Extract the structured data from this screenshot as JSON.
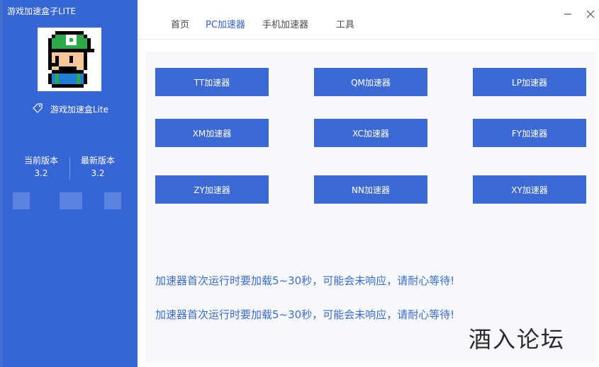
{
  "app": {
    "title": "游戏加速盒子LITE",
    "name": "游戏加速盒Lite"
  },
  "versions": {
    "current_label": "当前版本",
    "current_value": "3.2",
    "latest_label": "最新版本",
    "latest_value": "3.2"
  },
  "nav": {
    "tabs": [
      {
        "label": "首页"
      },
      {
        "label": "PC加速器"
      },
      {
        "label": "手机加速器"
      },
      {
        "label": "工具"
      }
    ],
    "active_tab": "PC加速器"
  },
  "accelerators": [
    {
      "label": "TT加速器"
    },
    {
      "label": "QM加速器"
    },
    {
      "label": "LP加速器"
    },
    {
      "label": "XM加速器"
    },
    {
      "label": "XC加速器"
    },
    {
      "label": "FY加速器"
    },
    {
      "label": "ZY加速器"
    },
    {
      "label": "NN加速器"
    },
    {
      "label": "XY加速器"
    }
  ],
  "notices": [
    "加速器首次运行时要加载5~30秒，可能会未响应，请耐心等待!",
    "加速器首次运行时要加载5~30秒，可能会未响应，请耐心等待!"
  ],
  "watermark": "酒入论坛",
  "colors": {
    "sidebar": "#3665d6",
    "button": "#3d69d4",
    "accent_text": "#3a6ccf",
    "active_tab": "#2e5fd2"
  },
  "icons": [
    "tag-icon",
    "minimize-icon",
    "close-icon",
    "avatar-pixel-mario-image"
  ]
}
